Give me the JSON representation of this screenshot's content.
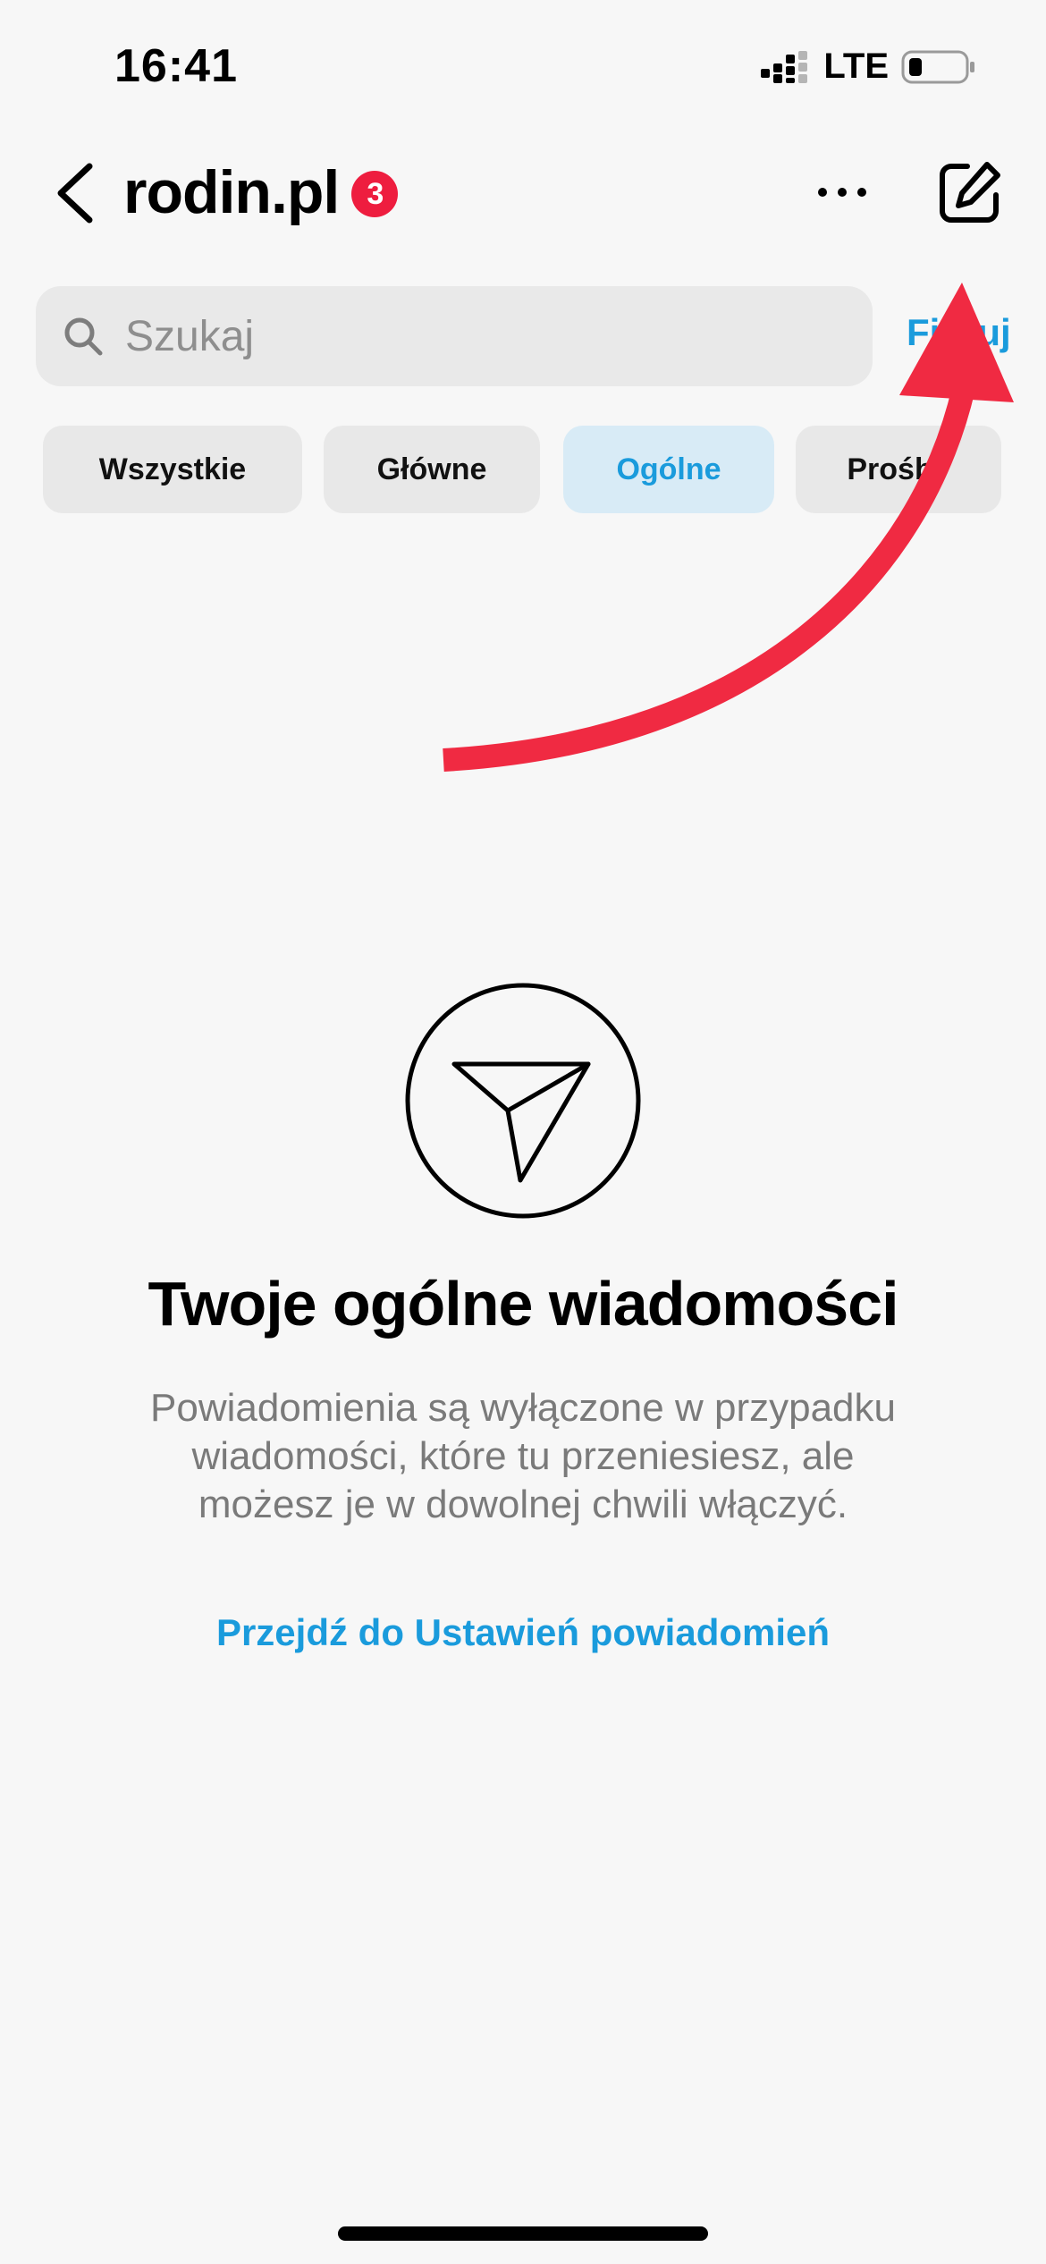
{
  "status_bar": {
    "time": "16:41",
    "network": "LTE",
    "icons": [
      "signal-icon",
      "battery-icon"
    ]
  },
  "header": {
    "account": "rodin.pl",
    "badge_count": "3",
    "icons": [
      "back-chevron-icon",
      "more-dots-icon",
      "compose-icon"
    ]
  },
  "search": {
    "placeholder": "Szukaj",
    "value": "",
    "filter_label": "Filtruj",
    "icon": "search-icon"
  },
  "tabs": [
    {
      "label": "Wszystkie",
      "active": false
    },
    {
      "label": "Główne",
      "active": false
    },
    {
      "label": "Ogólne",
      "active": true
    },
    {
      "label": "Prośby",
      "active": false
    }
  ],
  "empty_state": {
    "icon": "paper-plane-icon",
    "title": "Twoje ogólne wiadomości",
    "description": "Powiadomienia są wyłączone w przypadku wiadomości, które tu przeniesiesz, ale możesz je w dowolnej chwili włączyć.",
    "link": "Przejdź do Ustawień powiadomień"
  },
  "overlay": {
    "annotation": "arrow-icon",
    "color": "#f02a42"
  },
  "colors": {
    "accent": "#1a9bdc",
    "badge": "#ee1d3f",
    "active_tab_bg": "#d8ebf6"
  }
}
